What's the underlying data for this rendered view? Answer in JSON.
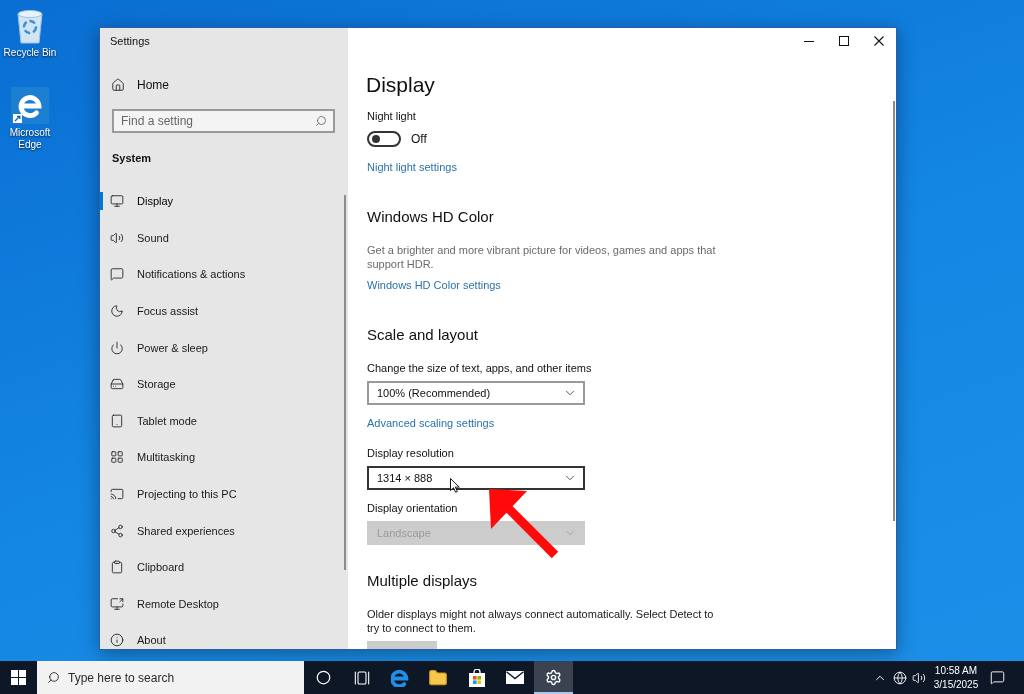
{
  "desktop": {
    "icons": [
      {
        "kind": "recycle_bin",
        "label": "Recycle Bin"
      },
      {
        "kind": "edge",
        "label": "Microsoft Edge"
      }
    ]
  },
  "window": {
    "title": "Settings"
  },
  "sidebar": {
    "home": "Home",
    "search": {
      "placeholder": "Find a setting"
    },
    "section": "System",
    "items": [
      {
        "kind": "display",
        "label": "Display",
        "selected": true
      },
      {
        "kind": "sound",
        "label": "Sound",
        "selected": false
      },
      {
        "kind": "notifications",
        "label": "Notifications & actions",
        "selected": false
      },
      {
        "kind": "focus",
        "label": "Focus assist",
        "selected": false
      },
      {
        "kind": "power",
        "label": "Power & sleep",
        "selected": false
      },
      {
        "kind": "storage",
        "label": "Storage",
        "selected": false
      },
      {
        "kind": "tablet",
        "label": "Tablet mode",
        "selected": false
      },
      {
        "kind": "multitasking",
        "label": "Multitasking",
        "selected": false
      },
      {
        "kind": "projecting",
        "label": "Projecting to this PC",
        "selected": false
      },
      {
        "kind": "shared",
        "label": "Shared experiences",
        "selected": false
      },
      {
        "kind": "clipboard",
        "label": "Clipboard",
        "selected": false
      },
      {
        "kind": "remote",
        "label": "Remote Desktop",
        "selected": false
      },
      {
        "kind": "about",
        "label": "About",
        "selected": false
      }
    ]
  },
  "page": {
    "title": "Display",
    "blocks": [
      {
        "kind": "label",
        "text": "Night light"
      },
      {
        "kind": "toggle",
        "on": false,
        "text": "Off"
      },
      {
        "kind": "link",
        "text": "Night light settings"
      },
      {
        "kind": "heading",
        "text": "Windows HD Color"
      },
      {
        "kind": "text",
        "muted": true,
        "text": "Get a brighter and more vibrant picture for videos, games and apps that support HDR."
      },
      {
        "kind": "link",
        "text": "Windows HD Color settings"
      },
      {
        "kind": "heading",
        "text": "Scale and layout"
      },
      {
        "kind": "label",
        "text": "Change the size of text, apps, and other items"
      },
      {
        "kind": "dropdown",
        "value": "100% (Recommended)",
        "hovered": false,
        "disabled": false
      },
      {
        "kind": "link",
        "text": "Advanced scaling settings"
      },
      {
        "kind": "label",
        "text": "Display resolution"
      },
      {
        "kind": "dropdown",
        "value": "1314 × 888",
        "hovered": true,
        "disabled": false
      },
      {
        "kind": "label",
        "text": "Display orientation"
      },
      {
        "kind": "dropdown",
        "value": "Landscape",
        "hovered": false,
        "disabled": true
      },
      {
        "kind": "heading",
        "text": "Multiple displays"
      },
      {
        "kind": "text",
        "muted": false,
        "text": "Older displays might not always connect automatically. Select Detect to try to connect to them."
      },
      {
        "kind": "button"
      }
    ]
  },
  "taskbar": {
    "search": {
      "placeholder": "Type here to search"
    },
    "apps": [
      {
        "kind": "cortana",
        "active": false
      },
      {
        "kind": "task_view",
        "active": false
      },
      {
        "kind": "edge",
        "active": false
      },
      {
        "kind": "explorer",
        "active": false
      },
      {
        "kind": "store",
        "active": false
      },
      {
        "kind": "mail",
        "active": false
      },
      {
        "kind": "settings",
        "active": true
      }
    ],
    "tray": {
      "time": "10:58 AM",
      "date": "3/15/2025"
    }
  }
}
